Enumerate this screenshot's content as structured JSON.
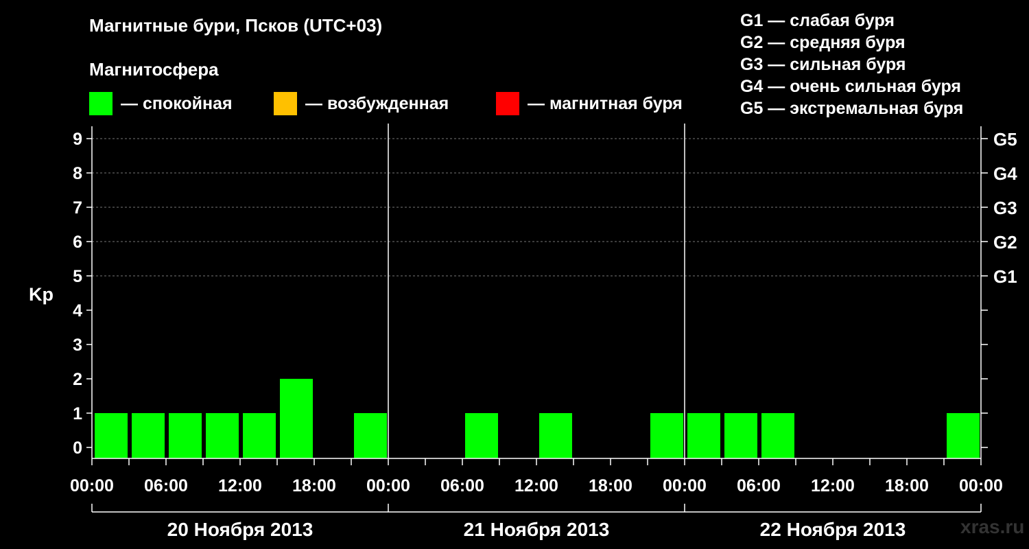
{
  "title": "Магнитные бури, Псков (UTC+03)",
  "subtitle": "Магнитосфера",
  "legend": [
    {
      "label": "— спокойная",
      "color": "#00ff00"
    },
    {
      "label": "— возбужденная",
      "color": "#ffc000"
    },
    {
      "label": "— магнитная буря",
      "color": "#ff0000"
    }
  ],
  "g_legend": [
    "G1 — слабая буря",
    "G2 — средняя буря",
    "G3 — сильная буря",
    "G4 — очень сильная буря",
    "G5 — экстремальная буря"
  ],
  "watermark": "xras.ru",
  "chart_data": {
    "type": "bar",
    "ylabel": "Kp",
    "ylim": [
      0,
      9
    ],
    "y_ticks": [
      0,
      1,
      2,
      3,
      4,
      5,
      6,
      7,
      8,
      9
    ],
    "g_levels": [
      {
        "label": "G1",
        "kp": 5
      },
      {
        "label": "G2",
        "kp": 6
      },
      {
        "label": "G3",
        "kp": 7
      },
      {
        "label": "G4",
        "kp": 8
      },
      {
        "label": "G5",
        "kp": 9
      }
    ],
    "x_tick_labels": [
      "00:00",
      "06:00",
      "12:00",
      "18:00",
      "00:00",
      "06:00",
      "12:00",
      "18:00",
      "00:00",
      "06:00",
      "12:00",
      "18:00",
      "00:00"
    ],
    "days": [
      "20 Ноября 2013",
      "21 Ноября 2013",
      "22 Ноября 2013"
    ],
    "interval_hours": 3,
    "values": [
      1,
      1,
      1,
      1,
      1,
      2,
      0,
      1,
      0,
      0,
      1,
      0,
      1,
      0,
      0,
      1,
      1,
      1,
      1,
      0,
      0,
      0,
      0,
      1
    ],
    "bar_color": "#00ff00",
    "grid": true
  }
}
